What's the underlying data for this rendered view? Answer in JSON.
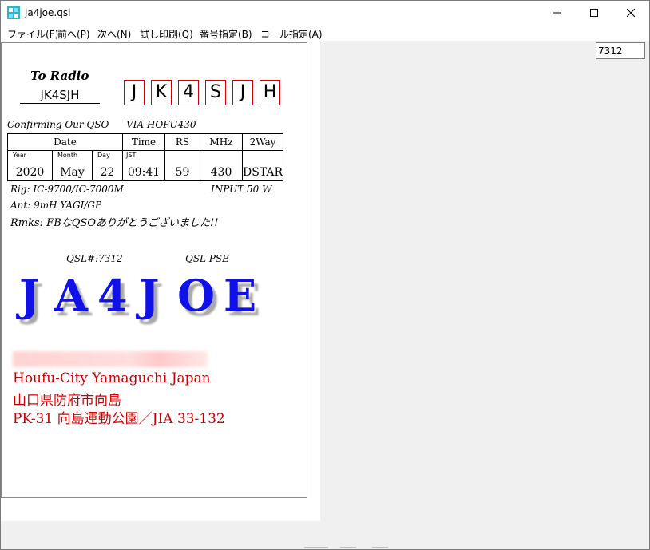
{
  "window": {
    "title": "ja4joe.qsl",
    "minimize": "—",
    "maximize": "☐",
    "close": "✕"
  },
  "menu": [
    "ファイル(F)",
    "前へ(P)",
    "次へ(N)",
    "試し印刷(Q)",
    "番号指定(B)",
    "コール指定(A)"
  ],
  "qsl_number_input": {
    "value": "7312"
  },
  "card": {
    "to_radio": "To Radio",
    "to_callsign": "JK4SJH",
    "callsign_boxes": [
      "J",
      "K",
      "4",
      "S",
      "J",
      "H"
    ],
    "confirming": "Confirming Our QSO",
    "via": "VIA HOFU430",
    "table": {
      "headers": {
        "date": "Date",
        "time": "Time",
        "rs": "RS",
        "mhz": "MHz",
        "mode": "2Way"
      },
      "sub_labels": {
        "year": "Year",
        "month": "Month",
        "day": "Day",
        "tz": "JST"
      },
      "values": {
        "year": "2020",
        "month": "May",
        "day": "22",
        "time": "09:41",
        "rs": "59",
        "mhz": "430",
        "mode": "DSTAR"
      }
    },
    "rig": "Rig:  IC-9700/IC-7000M",
    "power": "INPUT 50 W",
    "ant": "Ant: 9mH YAGI/GP",
    "rmks": "Rmks: FBなQSOありがとうございました!!",
    "qsl_no": "QSL#:7312",
    "qsl_pse": "QSL PSE",
    "own_call": [
      "J",
      "A",
      "4",
      "J",
      "O",
      "E"
    ],
    "address": [
      "Houfu-City Yamaguchi Japan",
      "山口県防府市向島",
      "PK-31 向島運動公園／JIA 33-132"
    ]
  }
}
